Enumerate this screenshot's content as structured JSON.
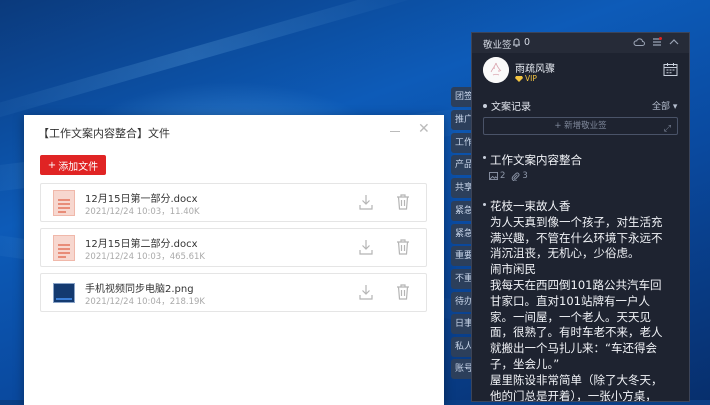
{
  "file_window": {
    "title": "【工作文案内容整合】文件",
    "add_button": "添加文件",
    "files": [
      {
        "name": "12月15日第一部分.docx",
        "meta": "2021/12/24 10:03，11.40K"
      },
      {
        "name": "12月15日第二部分.docx",
        "meta": "2021/12/24 10:03，465.61K"
      },
      {
        "name": "手机视频同步电脑2.png",
        "meta": "2021/12/24 10:04，218.19K"
      }
    ]
  },
  "side_tabs": [
    "团签",
    "推广",
    "工作",
    "产品",
    "共享",
    "紧急",
    "紧急",
    "重要",
    "不重",
    "待办",
    "日事",
    "私人",
    "账号"
  ],
  "notes_panel": {
    "title": "敬业签",
    "notification_count": "0",
    "user": {
      "name": "雨疏风骤",
      "badge": "VIP"
    },
    "section_title": "文案记录",
    "filter": "全部",
    "new_note_label": "+ 新增敬业签",
    "notes": [
      {
        "title": "工作文案内容整合",
        "images": "2",
        "files": "3"
      },
      {
        "lines": [
          "花枝一束故人香",
          "为人天真到像一个孩子，对生活充",
          "满兴趣，不管在什么环境下永远不",
          "消沉沮丧，无机心，少俗虑。",
          "闹市闲民",
          "我每天在西四倒101路公共汽车回",
          "甘家口。直对101站牌有一户人",
          "家。一间屋，一个老人。天天见",
          "面，很熟了。有时车老不来，老人",
          "就搬出一个马扎儿来：“车还得会",
          "子，坐会儿。”",
          "屋里陈设非常简单（除了大冬天，",
          "他的门总是开着），一张小方桌，"
        ]
      }
    ]
  },
  "colors": {
    "accent_red": "#e02424",
    "panel_bg": "#1e2330",
    "vip_gold": "#f4c542"
  }
}
